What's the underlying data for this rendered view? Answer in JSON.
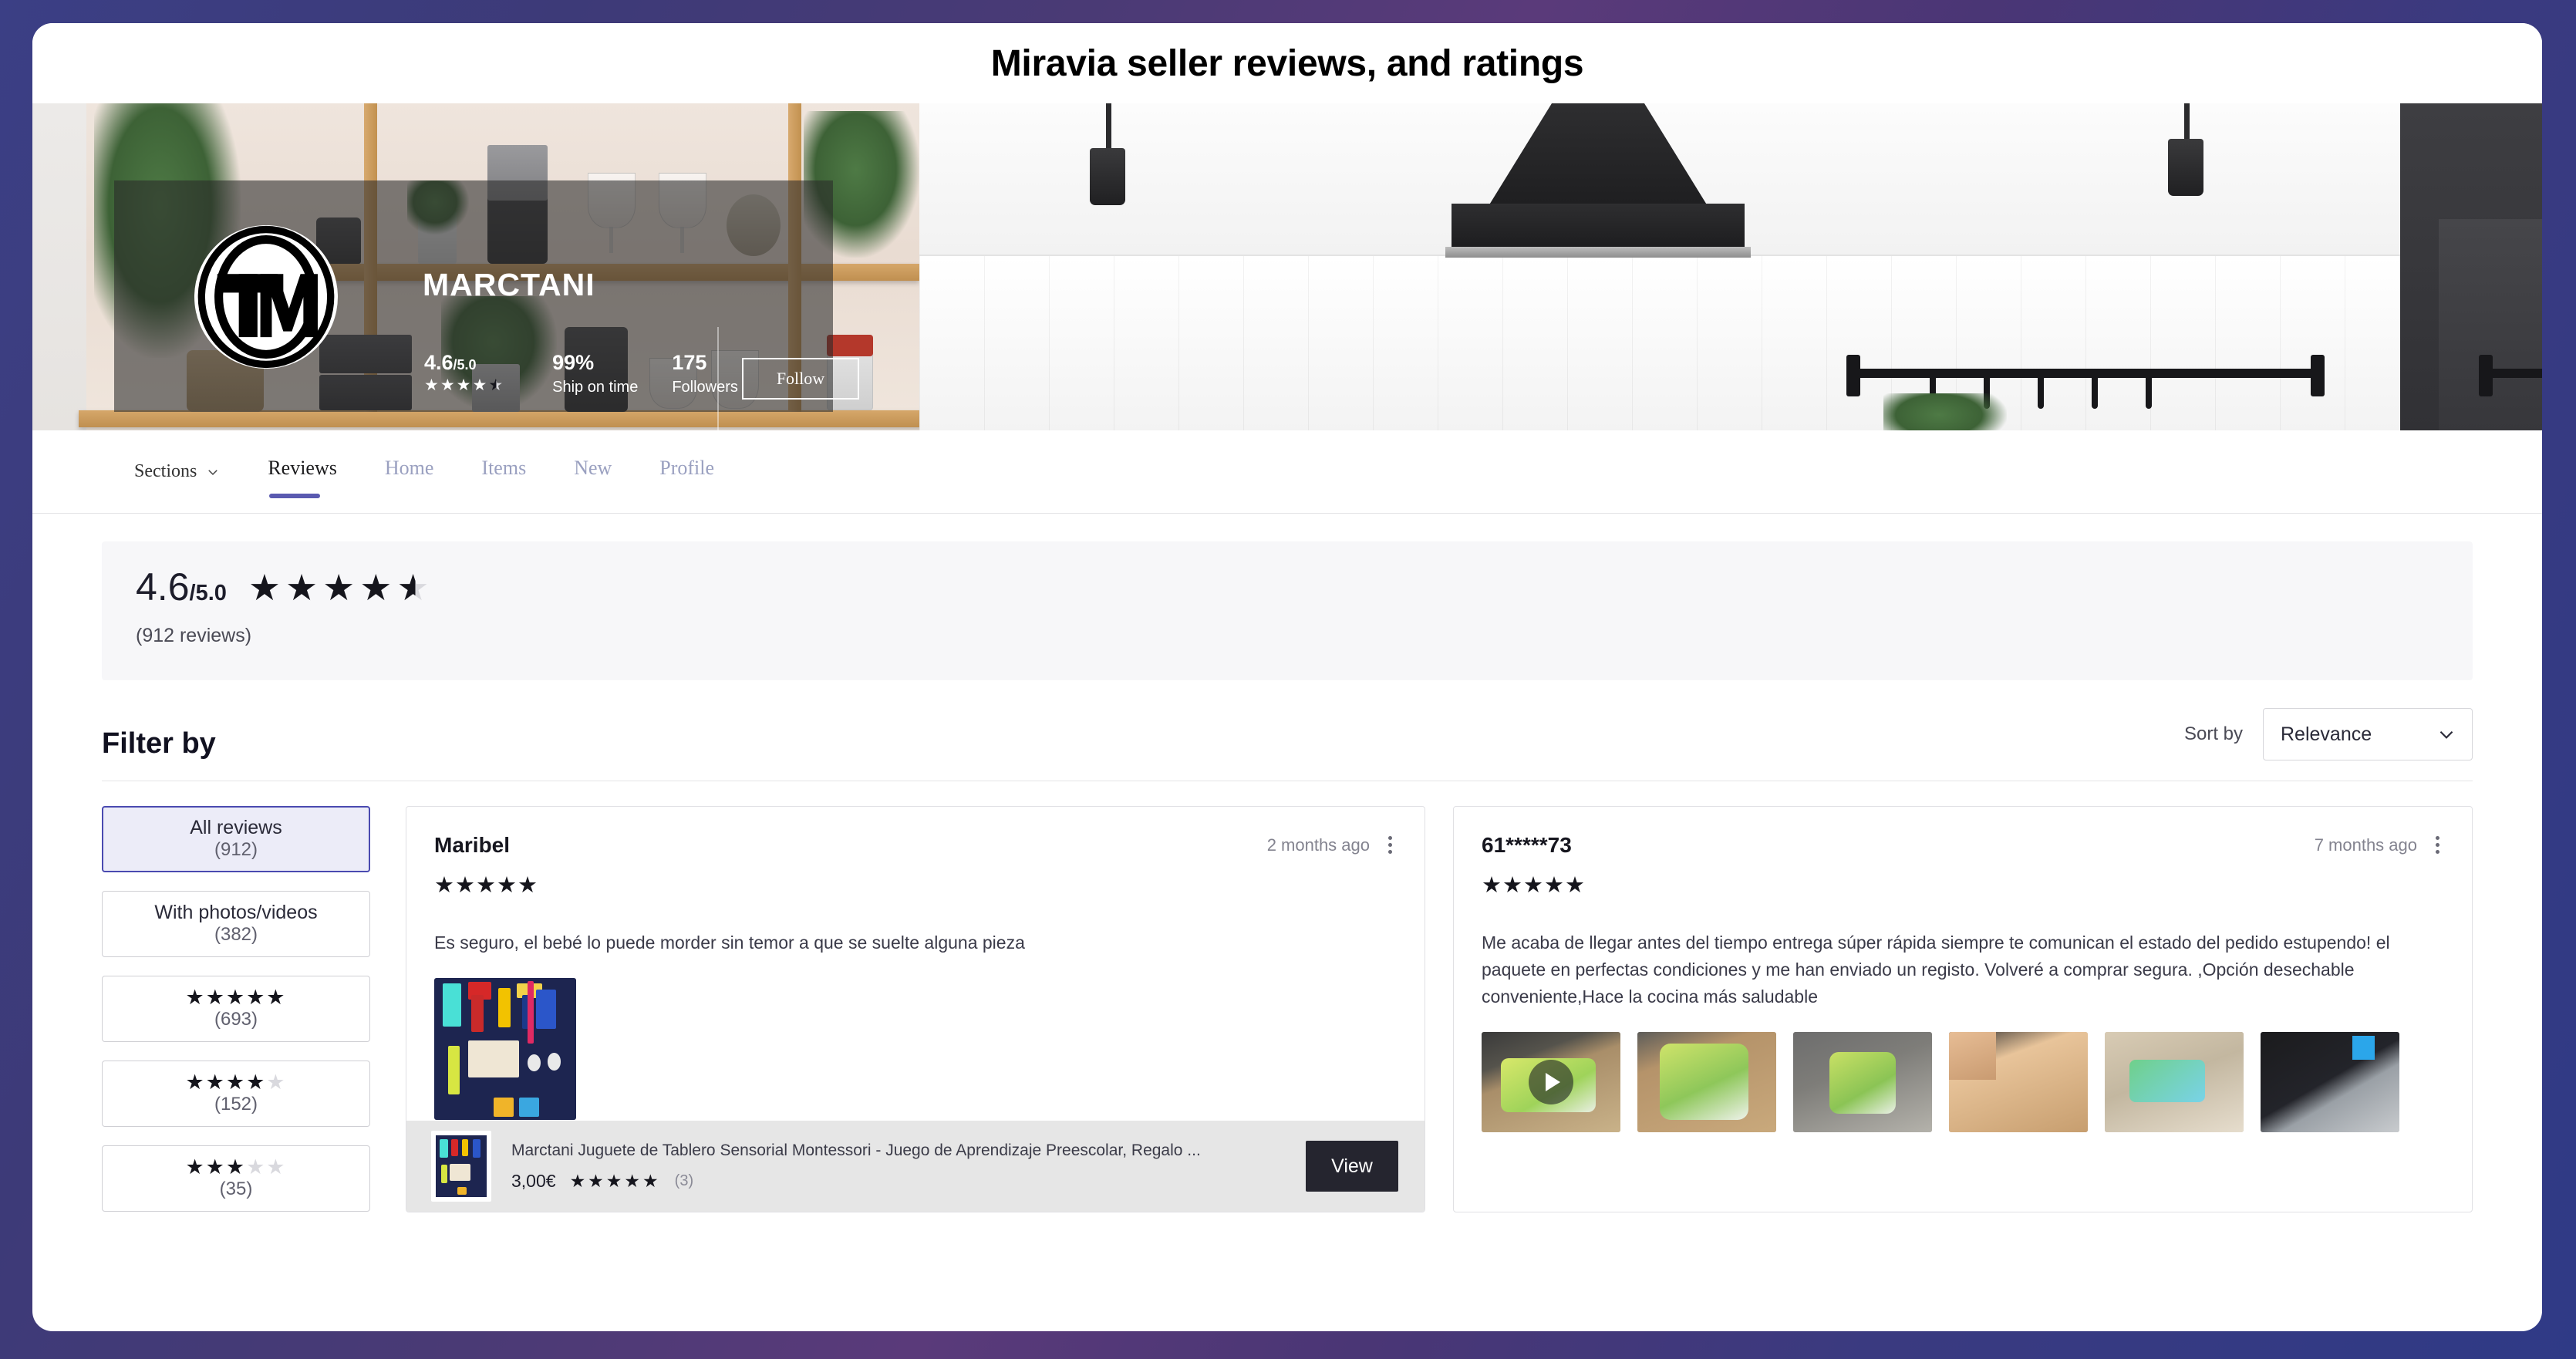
{
  "page_title": "Miravia seller reviews, and ratings",
  "seller": {
    "name": "MARCTANI",
    "logo_text": "TM",
    "rating": "4.6",
    "rating_suffix": "/5.0",
    "rating_stars": "★★★★",
    "rating_half_star": "★",
    "ship_on_time": "99%",
    "ship_on_time_label": "Ship on time",
    "followers": "175",
    "followers_label": "Followers",
    "follow_button": "Follow"
  },
  "nav": {
    "sections_label": "Sections",
    "tabs": [
      {
        "label": "Reviews",
        "active": true
      },
      {
        "label": "Home",
        "active": false
      },
      {
        "label": "Items",
        "active": false
      },
      {
        "label": "New",
        "active": false
      },
      {
        "label": "Profile",
        "active": false
      }
    ]
  },
  "rating_summary": {
    "score": "4.6",
    "out_of": "/5.0",
    "stars_full": "★★★★",
    "stars_half": "★",
    "reviews_count": "(912 reviews)"
  },
  "filter": {
    "title": "Filter by",
    "sort_label": "Sort by",
    "sort_value": "Relevance",
    "options": [
      {
        "label": "All reviews",
        "count": "(912)",
        "selected": true,
        "stars_on": 0,
        "stars_off": 0
      },
      {
        "label": "With photos/videos",
        "count": "(382)",
        "selected": false,
        "stars_on": 0,
        "stars_off": 0
      },
      {
        "label": "",
        "count": "(693)",
        "selected": false,
        "stars_on": 5,
        "stars_off": 0
      },
      {
        "label": "",
        "count": "(152)",
        "selected": false,
        "stars_on": 4,
        "stars_off": 1
      },
      {
        "label": "",
        "count": "(35)",
        "selected": false,
        "stars_on": 3,
        "stars_off": 2
      }
    ]
  },
  "reviews": [
    {
      "author": "Maribel",
      "date": "2 months ago",
      "stars": "★★★★★",
      "text": "Es seguro, el bebé lo puede morder sin temor a que se suelte alguna pieza",
      "has_media": true,
      "product": {
        "name": "Marctani Juguete de Tablero Sensorial Montessori - Juego de Aprendizaje Preescolar, Regalo ...",
        "price": "3,00€",
        "stars": "★★★★★",
        "review_count": "(3)",
        "view_label": "View"
      }
    },
    {
      "author": "61*****73",
      "date": "7 months ago",
      "stars": "★★★★★",
      "text": "Me acaba de llegar antes del tiempo entrega súper rápida siempre te comunican el estado del pedido estupendo! el paquete en perfectas condiciones y me han enviado un registo. Volveré a comprar segura. ,Opción desechable conveniente,Hace la cocina más saludable",
      "has_media": true
    }
  ],
  "colors": {
    "accent": "#5a5ab0",
    "selected_filter_bg": "#ececf8",
    "selected_filter_border": "#4a4ab0",
    "star_on": "#15151c",
    "star_off": "#d9d9de",
    "view_button": "#25252f",
    "page_bg": "#3d3a78"
  }
}
